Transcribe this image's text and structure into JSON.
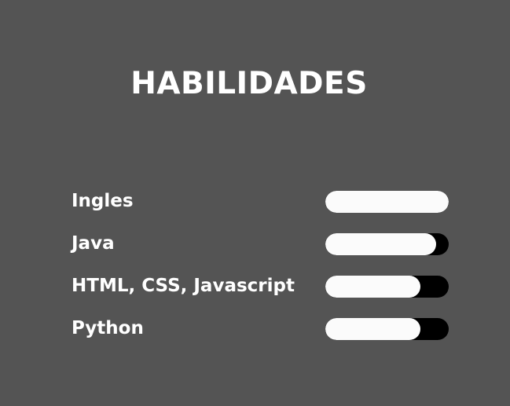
{
  "page": {
    "title": "HABILIDADES",
    "background_color": "#545454",
    "text_color": "#ffffff"
  },
  "skills": [
    {
      "label": "Ingles",
      "level": 1.0
    },
    {
      "label": "Java",
      "level": 0.9
    },
    {
      "label": "HTML, CSS, Javascript",
      "level": 0.77
    },
    {
      "label": "Python",
      "level": 0.77
    }
  ],
  "bar_colors": {
    "fill": "#fbfbfb",
    "track": "#000000"
  }
}
